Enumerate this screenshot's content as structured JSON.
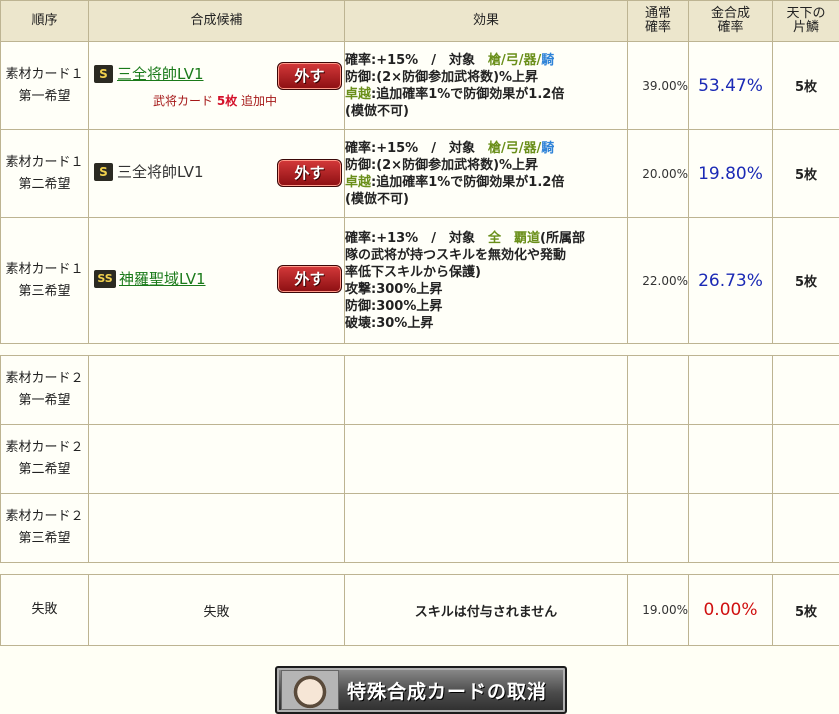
{
  "headers": {
    "order": "順序",
    "candidate": "合成候補",
    "effect": "効果",
    "normal_rate": "通常確率",
    "gold_rate": "金合成確率",
    "tenka": "天下の片鱗"
  },
  "rows": [
    {
      "order1": "素材カード１",
      "order2": "第一希望",
      "rank": "S",
      "name": "三全将帥LV1",
      "name_link": true,
      "sub_prefix": "武将カード",
      "sub_count": "5枚",
      "sub_suffix": "追加中",
      "remove": "外す",
      "effect": {
        "p1": "確率:+15%　/　対象　",
        "t1": "槍",
        "s1": "/",
        "t2": "弓",
        "s2": "/",
        "t3": "器",
        "s3": "/",
        "t4": "騎",
        "l2": "防御:(2×防御参加武将数)%上昇",
        "l3a": "卓越",
        "l3b": ":追加確率1%で防御効果が1.2倍",
        "l4": "(模倣不可)"
      },
      "normal": "39.00%",
      "gold": "53.47%",
      "tenka": "5枚"
    },
    {
      "order1": "素材カード１",
      "order2": "第二希望",
      "rank": "S",
      "name": "三全将帥LV1",
      "name_link": false,
      "remove": "外す",
      "effect": {
        "p1": "確率:+15%　/　対象　",
        "t1": "槍",
        "s1": "/",
        "t2": "弓",
        "s2": "/",
        "t3": "器",
        "s3": "/",
        "t4": "騎",
        "l2": "防御:(2×防御参加武将数)%上昇",
        "l3a": "卓越",
        "l3b": ":追加確率1%で防御効果が1.2倍",
        "l4": "(模倣不可)"
      },
      "normal": "20.00%",
      "gold": "19.80%",
      "tenka": "5枚"
    },
    {
      "order1": "素材カード１",
      "order2": "第三希望",
      "rank": "SS",
      "name": "神羅聖域LV1",
      "name_link": true,
      "remove": "外す",
      "effect": {
        "p1": "確率:+13%　/　対象　",
        "t1": "全",
        "t2": "覇道",
        "p1b": "(所属部",
        "l2": "隊の武将が持つスキルを無効化や発動",
        "l3": "率低下スキルから保護)",
        "l4": "攻撃:300%上昇",
        "l5": "防御:300%上昇",
        "l6": "破壊:30%上昇"
      },
      "normal": "22.00%",
      "gold": "26.73%",
      "tenka": "5枚"
    }
  ],
  "empty_rows": [
    {
      "order1": "素材カード２",
      "order2": "第一希望"
    },
    {
      "order1": "素材カード２",
      "order2": "第二希望"
    },
    {
      "order1": "素材カード２",
      "order2": "第三希望"
    }
  ],
  "fail": {
    "order": "失敗",
    "candidate": "失敗",
    "effect": "スキルは付与されません",
    "normal": "19.00%",
    "gold": "0.00%",
    "tenka": "5枚"
  },
  "cancel_button": "特殊合成カードの取消"
}
